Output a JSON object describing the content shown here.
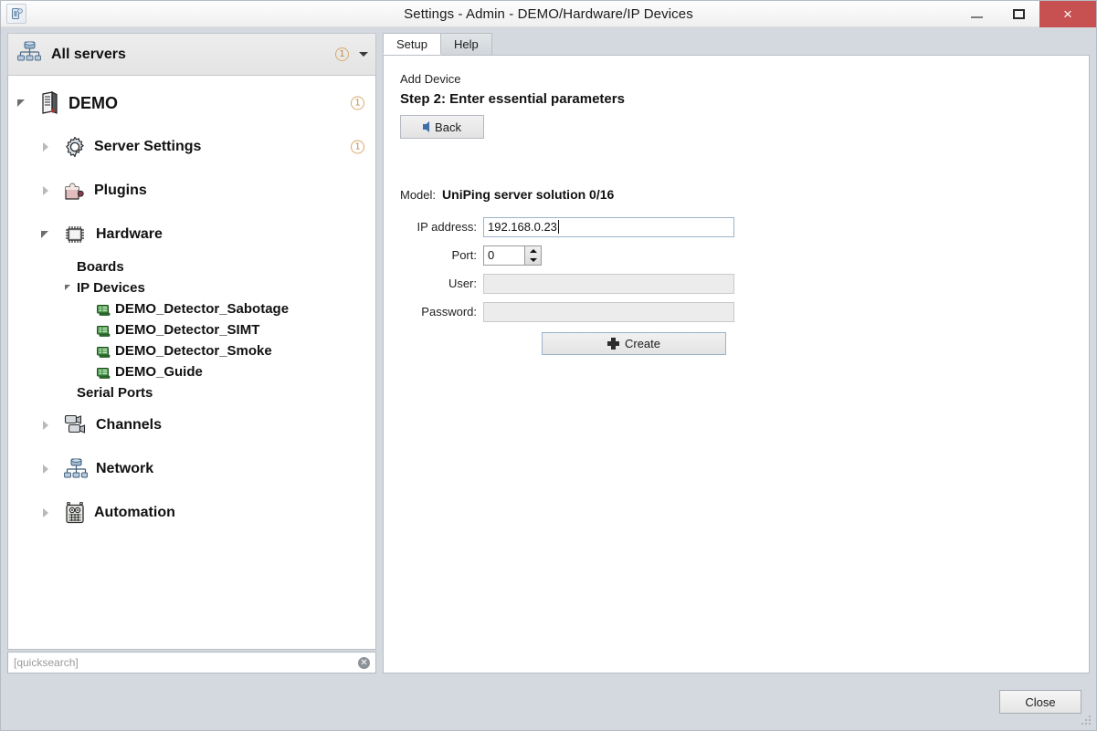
{
  "window": {
    "title": "Settings - Admin - DEMO/Hardware/IP Devices",
    "app_icon": "app-logo-icon",
    "minimize_label": "—",
    "maximize_label": "□",
    "close_label": "×",
    "close_button_color": "#c75050"
  },
  "sidebar": {
    "header": {
      "label": "All servers",
      "icon": "network-servers-icon",
      "badge": "1",
      "caret": "chevron-down-icon"
    },
    "tree": [
      {
        "label": "DEMO",
        "icon": "server-icon",
        "level": 0,
        "twist": "open",
        "badge": "1",
        "size": "l18"
      },
      {
        "label": "Server Settings",
        "icon": "gear-icon",
        "level": 1,
        "twist": "closed",
        "badge": "1",
        "size": "l16"
      },
      {
        "label": "Plugins",
        "icon": "puzzle-piece-icon",
        "level": 1,
        "twist": "closed",
        "badge": null,
        "size": "l16"
      },
      {
        "label": "Hardware",
        "icon": "chip-icon",
        "level": 1,
        "twist": "open",
        "badge": null,
        "size": "l16"
      },
      {
        "label": "Boards",
        "icon": null,
        "level": 2,
        "twist": null,
        "badge": null,
        "size": "l15"
      },
      {
        "label": "IP Devices",
        "icon": null,
        "level": 2,
        "twist": "open",
        "badge": null,
        "size": "l15"
      },
      {
        "label": "DEMO_Detector_Sabotage",
        "icon": "ip-device-icon",
        "level": 3,
        "twist": null,
        "badge": null,
        "size": "l15"
      },
      {
        "label": "DEMO_Detector_SIMT",
        "icon": "ip-device-icon",
        "level": 3,
        "twist": null,
        "badge": null,
        "size": "l15"
      },
      {
        "label": "DEMO_Detector_Smoke",
        "icon": "ip-device-icon",
        "level": 3,
        "twist": null,
        "badge": null,
        "size": "l15"
      },
      {
        "label": "DEMO_Guide",
        "icon": "ip-device-icon",
        "level": 3,
        "twist": null,
        "badge": null,
        "size": "l15"
      },
      {
        "label": "Serial Ports",
        "icon": null,
        "level": 2,
        "twist": null,
        "badge": null,
        "size": "l15"
      },
      {
        "label": "Channels",
        "icon": "cameras-icon",
        "level": 1,
        "twist": "closed",
        "badge": null,
        "size": "l16"
      },
      {
        "label": "Network",
        "icon": "network-icon",
        "level": 1,
        "twist": "closed",
        "badge": null,
        "size": "l16"
      },
      {
        "label": "Automation",
        "icon": "robot-icon",
        "level": 1,
        "twist": "closed",
        "badge": null,
        "size": "l16"
      }
    ],
    "quicksearch": {
      "placeholder": "[quicksearch]",
      "value": "",
      "clear_icon": "clear-circle-icon"
    }
  },
  "main": {
    "tabs": [
      {
        "label": "Setup",
        "active": true
      },
      {
        "label": "Help",
        "active": false
      }
    ],
    "wizard": {
      "heading": "Add Device",
      "step": "Step 2: Enter essential parameters",
      "back_label": "Back",
      "back_icon": "arrow-left-icon"
    },
    "model": {
      "label": "Model:",
      "value": "UniPing server solution 0/16"
    },
    "fields": [
      {
        "label": "IP address:",
        "value": "192.168.0.23",
        "type": "text",
        "disabled": false,
        "focused": true
      },
      {
        "label": "Port:",
        "value": "0",
        "type": "spinner",
        "disabled": false,
        "focused": false
      },
      {
        "label": "User:",
        "value": "",
        "type": "text",
        "disabled": true,
        "focused": false
      },
      {
        "label": "Password:",
        "value": "",
        "type": "password",
        "disabled": true,
        "focused": false
      }
    ],
    "create_button": {
      "label": "Create",
      "icon": "plus-icon"
    }
  },
  "footer": {
    "close_label": "Close",
    "resize_grip": "resize-grip-icon"
  }
}
